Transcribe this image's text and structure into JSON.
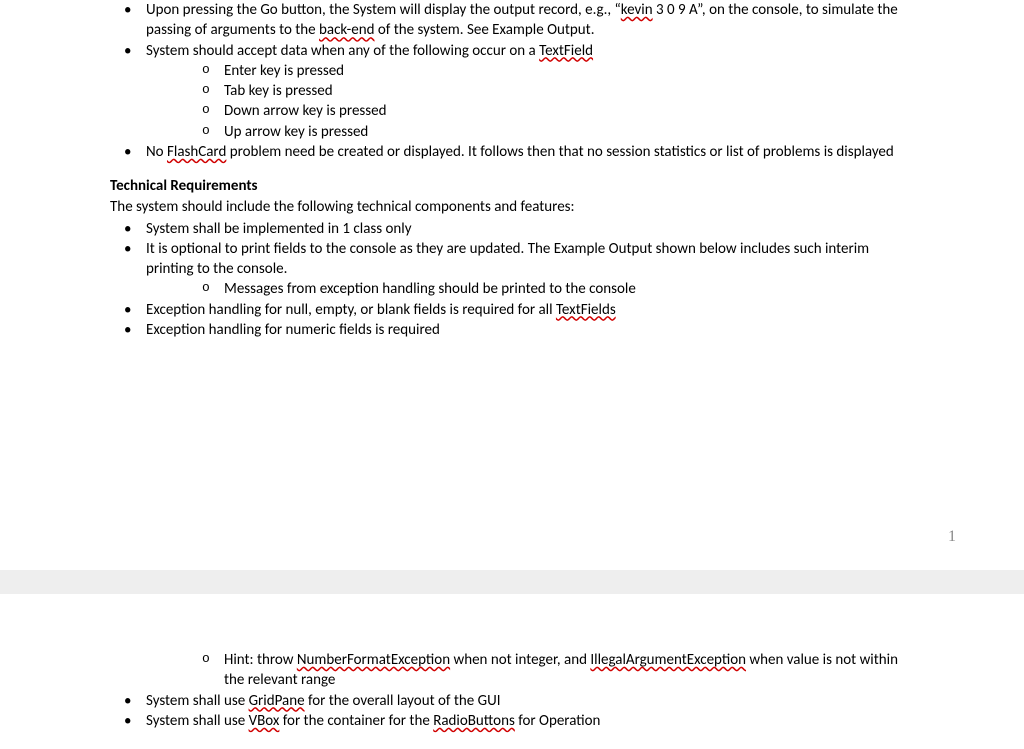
{
  "page1": {
    "b1_pre": "Upon pressing the Go button, the System will display the output record, e.g., “",
    "b1_sp1": "kevin",
    "b1_mid1": " 3 0 9 A”, on the console, to simulate the passing of arguments to the ",
    "b1_sp2": "back-end",
    "b1_post": " of the system.  See Example Output.",
    "b2_pre": "System should accept data when any of the following occur on a ",
    "b2_sp": "TextField",
    "b2c1": "Enter key is pressed",
    "b2c2": "Tab key is pressed",
    "b2c3": "Down arrow key is pressed",
    "b2c4": "Up arrow key is pressed",
    "b3_pre": "No ",
    "b3_sp": "FlashCard",
    "b3_post": " problem need be created or displayed.  It follows then that no session statistics or list of problems is displayed"
  },
  "tech": {
    "heading": "Technical Requirements",
    "intro": "The system should include the following technical components and features:",
    "t1": "System shall be implemented in 1 class only",
    "t2": "It is optional to print fields to the console as they are updated.  The Example Output shown below includes such interim printing to the console.",
    "t2c1": "Messages from exception handling should be printed to the console",
    "t3_pre": "Exception handling for null, empty, or blank fields is required for all ",
    "t3_sp": "TextFields",
    "t4": "Exception handling for numeric fields is required"
  },
  "pageNum": "1",
  "page2": {
    "c1_pre": "Hint: throw ",
    "c1_sp1": "NumberFormatException",
    "c1_mid": " when not integer, and ",
    "c1_sp2": "IllegalArgumentException",
    "c1_post": " when value is not within the relevant range",
    "p1_pre": "System shall use ",
    "p1_sp": "GridPane",
    "p1_post": " for the overall layout of the GUI",
    "p2_pre": "System shall use ",
    "p2_sp": "VBox",
    "p2_mid": " for the container for the ",
    "p2_sp2": "RadioButtons",
    "p2_post": " for Operation"
  }
}
